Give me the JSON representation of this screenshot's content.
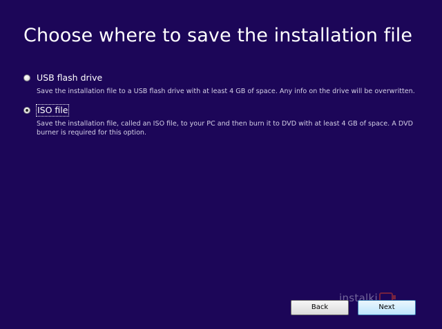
{
  "page": {
    "title": "Choose where to save the installation file"
  },
  "options": [
    {
      "label": "USB flash drive",
      "description": "Save the installation file to a USB flash drive with at least 4 GB of space. Any info on the drive will be overwritten.",
      "selected": false
    },
    {
      "label": "ISO file",
      "description": "Save the installation file, called an ISO file, to your PC and then burn it to DVD with at least 4 GB of space. A DVD burner is required for this option.",
      "selected": true
    }
  ],
  "buttons": {
    "back_label": "Back",
    "next_label": "Next"
  },
  "watermark": {
    "text": "instalki"
  },
  "colors": {
    "background": "#1c0658",
    "text": "#ffffff",
    "description": "#d4d0e6"
  }
}
